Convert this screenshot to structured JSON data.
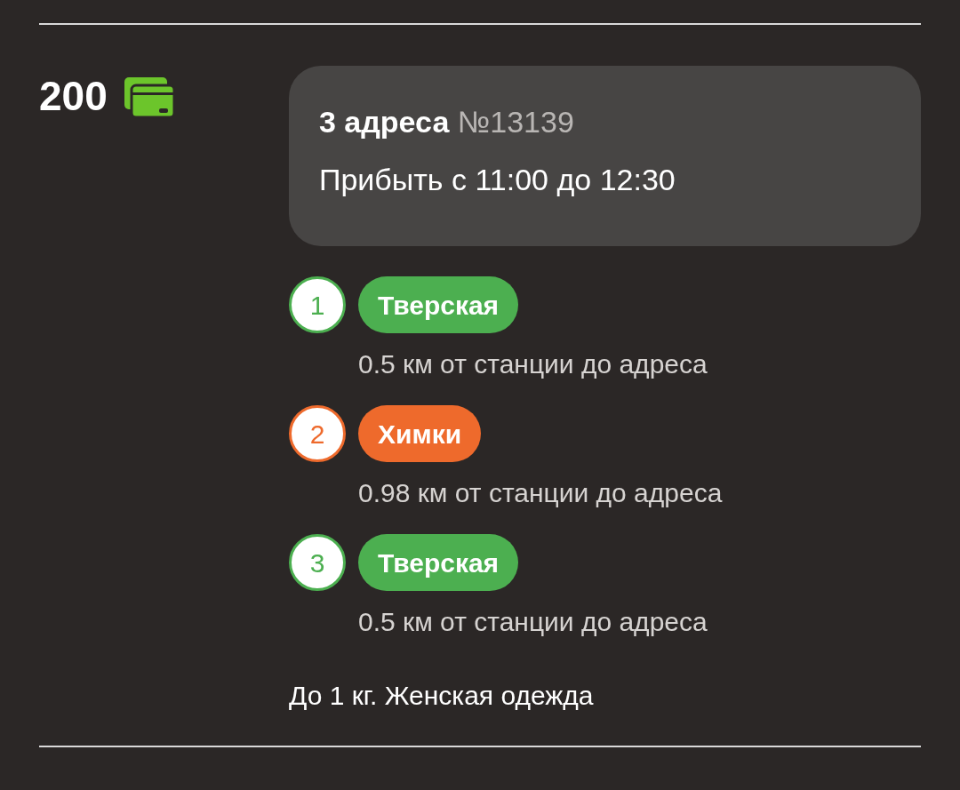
{
  "price": "200",
  "order": {
    "title": "3 адреса",
    "number": "№13139",
    "arrival": "Прибыть с 11:00 до 12:30"
  },
  "stops": [
    {
      "index": "1",
      "station": "Тверская",
      "color": "#4caf50",
      "distance": "0.5 км от станции до адреса"
    },
    {
      "index": "2",
      "station": "Химки",
      "color": "#ee6a2c",
      "distance": "0.98 км от станции до адреса"
    },
    {
      "index": "3",
      "station": "Тверская",
      "color": "#4caf50",
      "distance": "0.5 км от станции до адреса"
    }
  ],
  "note": "До 1 кг. Женская одежда"
}
